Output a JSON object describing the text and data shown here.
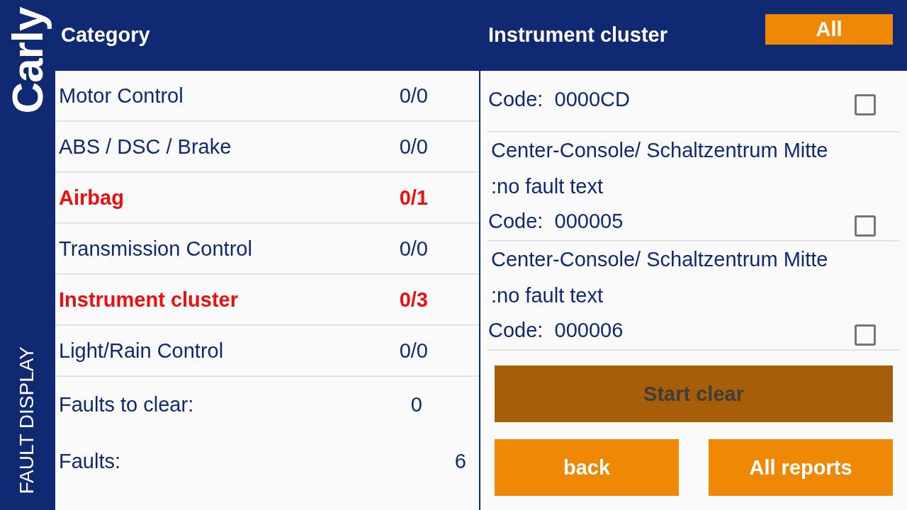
{
  "sidebar": {
    "logo": "Carly",
    "title": "FAULT DISPLAY"
  },
  "category_panel": {
    "heading": "Category",
    "categories": [
      {
        "name": "Motor Control",
        "count": "0/0",
        "has_faults": false
      },
      {
        "name": "ABS / DSC / Brake",
        "count": "0/0",
        "has_faults": false
      },
      {
        "name": "Airbag",
        "count": "0/1",
        "has_faults": true
      },
      {
        "name": "Transmission Control",
        "count": "0/0",
        "has_faults": false
      },
      {
        "name": "Instrument cluster",
        "count": "0/3",
        "has_faults": true
      },
      {
        "name": "Light/Rain Control",
        "count": "0/0",
        "has_faults": false
      }
    ],
    "summary": [
      {
        "label": "Faults to clear:",
        "value": "0"
      },
      {
        "label": "Faults:",
        "value": "6"
      }
    ]
  },
  "fault_panel": {
    "heading": "Instrument cluster",
    "filter_button": "All",
    "faults": [
      {
        "code": "Code:  0000CD",
        "checked": false
      },
      {
        "title": "Center-Console/ Schaltzentrum Mitte",
        "description": ":no fault text",
        "code": "Code:  000005",
        "checked": false
      },
      {
        "title": "Center-Console/ Schaltzentrum Mitte",
        "description": ":no fault text",
        "code": "Code:  000006",
        "checked": false
      }
    ],
    "start_button": {
      "label": "Start clear",
      "disabled": true
    },
    "buttons": [
      "back",
      "All reports"
    ]
  }
}
